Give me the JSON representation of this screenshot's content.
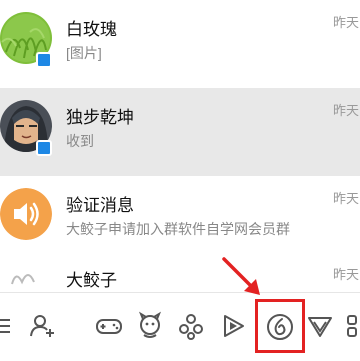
{
  "conversations": [
    {
      "name": "白玫瑰",
      "message": "[图片]",
      "time": "昨天"
    },
    {
      "name": "独步乾坤",
      "message": "收到",
      "time": "昨天"
    },
    {
      "name": "验证消息",
      "message": "大鲛子申请加入群软件自学网会员群",
      "time": "昨天"
    },
    {
      "name": "大鲛子",
      "message": "",
      "time": "昨天"
    }
  ],
  "colors": {
    "accent_highlight": "#e32222",
    "online_badge": "#1e88e5",
    "verify_avatar": "#f4a24a",
    "selected_row": "#e8e8e8"
  },
  "toolbar_icons": [
    "menu-icon",
    "add-contact-icon",
    "game-icon",
    "pet-icon",
    "cloud-icon",
    "video-play-icon",
    "music-icon",
    "shield-icon",
    "apps-icon"
  ]
}
